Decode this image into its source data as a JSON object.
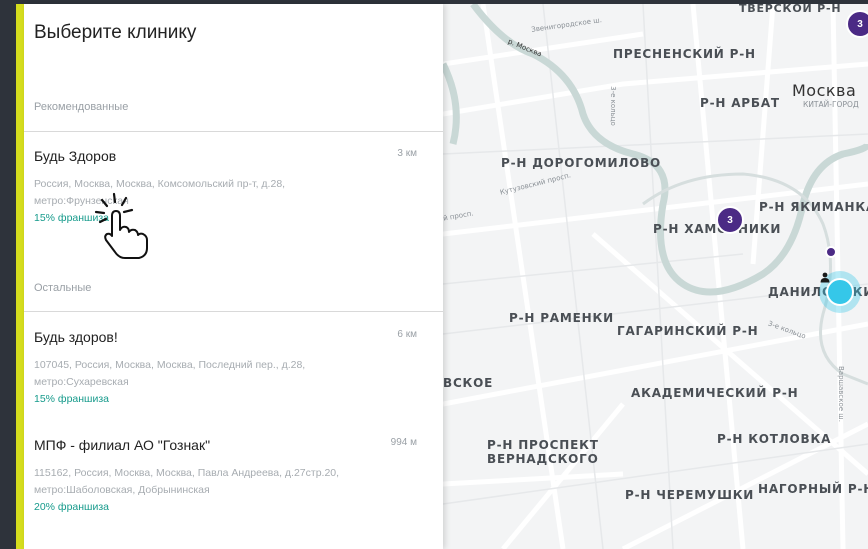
{
  "panel": {
    "title": "Выберите клинику",
    "recommended_label": "Рекомендованные",
    "others_label": "Остальные"
  },
  "recommended": [
    {
      "name": "Будь Здоров",
      "distance": "3 км",
      "address": "Россия, Москва, Москва, Комсомольский пр-т, д.28,",
      "metro": "метро:Фрунзенская",
      "franchise": "15% франшиза"
    }
  ],
  "others": [
    {
      "name": "Будь здоров!",
      "distance": "6 км",
      "address": "107045, Россия, Москва, Москва, Последний пер., д.28,",
      "metro": "метро:Сухаревская",
      "franchise": "15% франшиза"
    },
    {
      "name": "МПФ - филиал АО \"Гознак\"",
      "distance": "994 м",
      "address": "115162, Россия, Москва, Москва, Павла Андреева, д.27стр.20,",
      "metro": "метро:Шаболовская, Добрынинская",
      "franchise": "20% франшиза"
    }
  ],
  "map": {
    "districts": {
      "tverskoy": "ТВЕРСКОЙ Р-Н",
      "presnensky": "ПРЕСНЕНСКИЙ Р-Н",
      "arbat": "Р-Н АРБАТ",
      "city": "Москва",
      "kitay_gorod": "КИТАЙ-ГОРОД",
      "dorogomilovo": "Р-Н ДОРОГОМИЛОВО",
      "yakimanka": "Р-Н ЯКИМАНКА",
      "khamovniki": "Р-Н ХАМОВНИКИ",
      "danilovsky": "ДАНИЛОВСКИЙ",
      "ramenki": "Р-Н РАМЕНКИ",
      "gagarinsky": "ГАГАРИНСКИЙ Р-Н",
      "skoe": "ВСКОЕ",
      "akademichesky": "АКАДЕМИЧЕСКИЙ Р-Н",
      "vernadsky_1": "Р-Н ПРОСПЕКТ",
      "vernadsky_2": "ВЕРНАДСКОГО",
      "kotlovka": "Р-Н КОТЛОВКА",
      "cheremushki": "Р-Н ЧЕРЕМУШКИ",
      "nagorny": "НАГОРНЫЙ Р-Н"
    },
    "streets": {
      "zvenigorodskoe": "Звенигородское ш.",
      "river": "р. Москва",
      "ring_3": "3-е кольцо",
      "kutuzovsky": "Кутузовский просп.",
      "prosp": "й просп.",
      "ring_3b": "3-е кольцо",
      "varshavskoe": "Варшавское ш."
    },
    "clusters": {
      "top_right": "3",
      "khamovniki": "3"
    }
  }
}
